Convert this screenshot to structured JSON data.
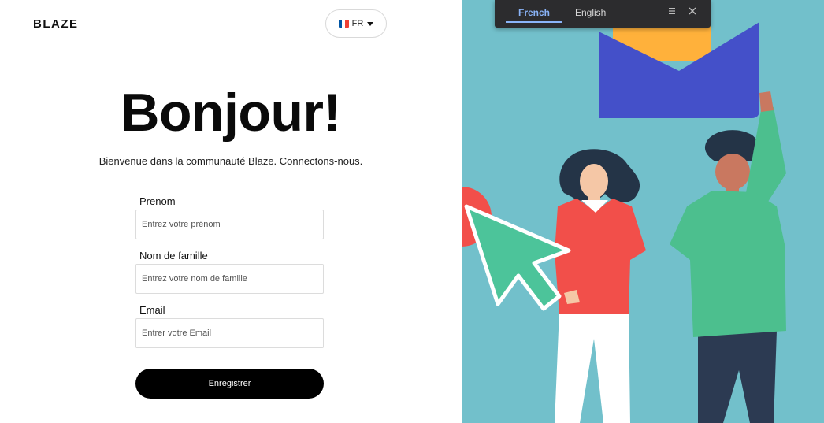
{
  "brand": {
    "logo": "BLAZE"
  },
  "language_selector": {
    "code": "FR",
    "flag_colors": [
      "#0055a4",
      "#ffffff",
      "#ef4135"
    ]
  },
  "hero": {
    "title": "Bonjour!",
    "subtitle": "Bienvenue dans la communauté Blaze. Connectons-nous."
  },
  "form": {
    "first_name": {
      "label": "Prenom",
      "placeholder": "Entrez votre prénom"
    },
    "last_name": {
      "label": "Nom de famille",
      "placeholder": "Entrez votre nom de famille"
    },
    "email": {
      "label": "Email",
      "placeholder": "Entrer votre Email"
    },
    "submit_label": "Enregistrer"
  },
  "translate_bar": {
    "tabs": [
      "French",
      "English"
    ],
    "active_tab": "French",
    "icons": [
      "menu-icon",
      "close-icon"
    ]
  },
  "illustration": {
    "colors": {
      "background": "#72c0cb",
      "envelope": "#4450c9",
      "letter": "#ffb13b",
      "cursor": "#4cc49a",
      "shirt_red": "#f24f4a",
      "sweater_green": "#4cbf8e",
      "hair": "#243447",
      "pants_navy": "#2c3a52"
    }
  }
}
